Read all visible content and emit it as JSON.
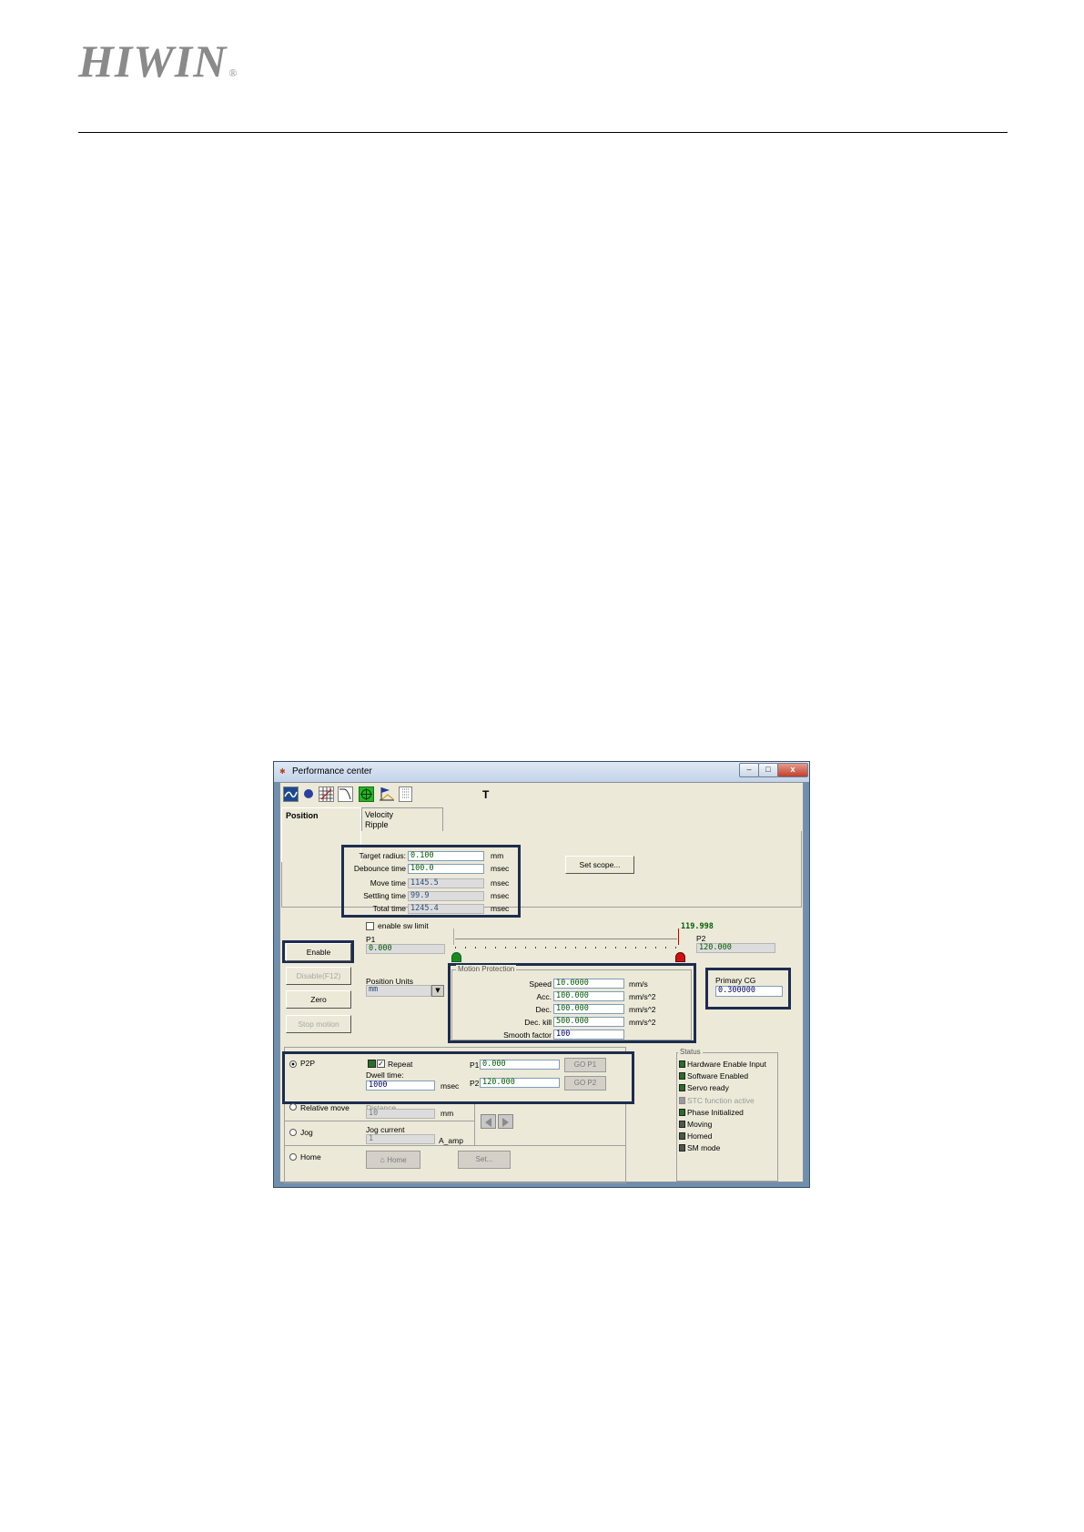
{
  "document": {
    "brand": "HIWIN",
    "brand_mark": "®"
  },
  "window": {
    "title": "Performance center",
    "controls": {
      "minimize": "–",
      "maximize": "□",
      "close": "x"
    }
  },
  "toolbar": {
    "icons": [
      "scope-icon",
      "dot-icon",
      "grid-icon",
      "curve-icon",
      "target-icon",
      "flag-icon",
      "list-icon"
    ],
    "t_label": "T"
  },
  "tabs": {
    "position": "Position",
    "velocity_line1": "Velocity",
    "velocity_line2": "Ripple"
  },
  "position_tab": {
    "target_radius": {
      "label": "Target radius:",
      "value": "0.100",
      "unit": "mm"
    },
    "debounce_time": {
      "label": "Debounce time",
      "value": "100.0",
      "unit": "msec"
    },
    "move_time": {
      "label": "Move time",
      "value": "1145.5",
      "unit": "msec"
    },
    "settling_time": {
      "label": "Settling time",
      "value": "99.9",
      "unit": "msec"
    },
    "total_time": {
      "label": "Total time",
      "value": "1245.4",
      "unit": "msec"
    },
    "set_scope": "Set scope..."
  },
  "control": {
    "enable": "Enable",
    "disable": "Disable(F12)",
    "zero": "Zero",
    "stop_motion": "Stop motion",
    "enable_sw_limit": "enable sw limit",
    "p1_label": "P1",
    "p1_value": "0.000",
    "p2_label": "P2",
    "p2_value": "120.000",
    "current_position": "119.998",
    "position_units_label": "Position Units",
    "position_units_value": "mm"
  },
  "motion_protection": {
    "title": "Motion Protection",
    "speed": {
      "label": "Speed",
      "value": "10.0000",
      "unit": "mm/s"
    },
    "acc": {
      "label": "Acc.",
      "value": "100.000",
      "unit": "mm/s^2"
    },
    "dec": {
      "label": "Dec.",
      "value": "100.000",
      "unit": "mm/s^2"
    },
    "dec_kill": {
      "label": "Dec. kill",
      "value": "500.000",
      "unit": "mm/s^2"
    },
    "smooth_factor": {
      "label": "Smooth factor",
      "value": "100"
    }
  },
  "primary_cg": {
    "label": "Primary CG",
    "value": "0.300000"
  },
  "modes": {
    "p2p": "P2P",
    "repeat": "Repeat",
    "dwell_label": "Dwell time:",
    "dwell_value": "1000",
    "dwell_unit": "msec",
    "p1_label": "P1",
    "p1_value": "0.000",
    "p2_label": "P2",
    "p2_value": "120.000",
    "go_p1": "GO P1",
    "go_p2": "GO P2",
    "relative_move": "Relative move",
    "distance_label": "Distance",
    "distance_value": "10",
    "distance_unit": "mm",
    "jog": "Jog",
    "jog_current_label": "Jog current",
    "jog_current_value": "1",
    "jog_current_unit": "A_amp",
    "home": "Home",
    "home_button": "Home",
    "set_button": "Set..."
  },
  "status": {
    "title": "Status",
    "items": [
      {
        "label": "Hardware Enable Input",
        "state": "on"
      },
      {
        "label": "Software Enabled",
        "state": "on"
      },
      {
        "label": "Servo ready",
        "state": "on"
      },
      {
        "label": "STC function active",
        "state": "disabled"
      },
      {
        "label": "Phase Initialized",
        "state": "on"
      },
      {
        "label": "Moving",
        "state": "off"
      },
      {
        "label": "Homed",
        "state": "off"
      },
      {
        "label": "SM mode",
        "state": "off"
      }
    ]
  }
}
